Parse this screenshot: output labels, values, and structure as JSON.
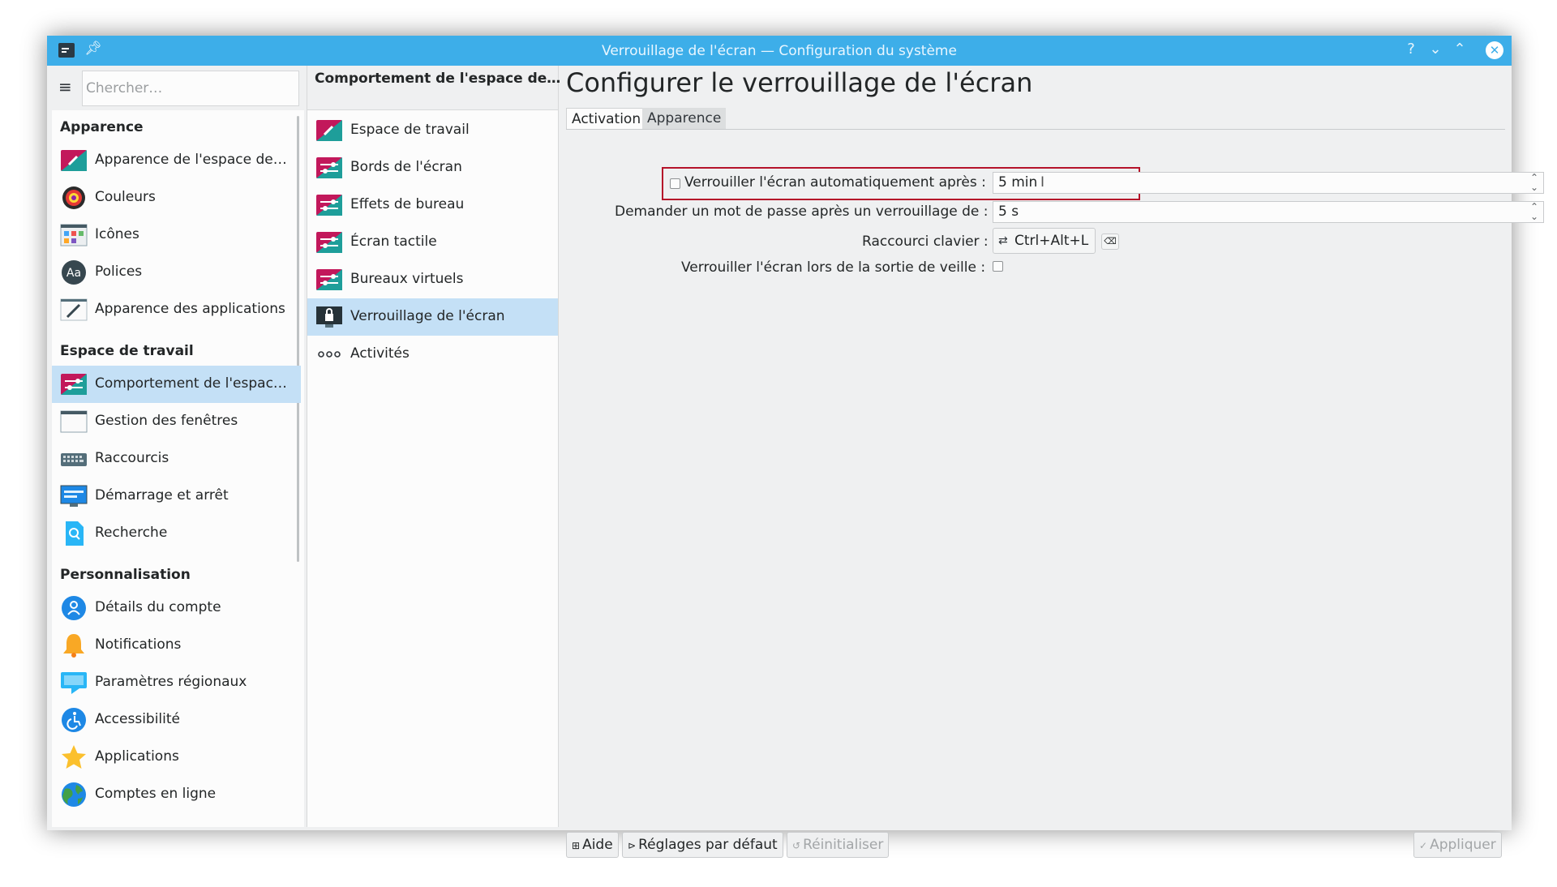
{
  "window": {
    "title": "Verrouillage de l'écran — Configuration du système",
    "controls": {
      "help": "?",
      "minimize": "⌄",
      "maximize": "⌃",
      "close": "✕"
    }
  },
  "sidebar": {
    "search_placeholder": "Chercher…",
    "sections": [
      {
        "title": "Apparence",
        "items": [
          {
            "label": "Apparence de l'espace de…",
            "icon": "workspace-theme-icon"
          },
          {
            "label": "Couleurs",
            "icon": "colors-icon"
          },
          {
            "label": "Icônes",
            "icon": "icons-icon"
          },
          {
            "label": "Polices",
            "icon": "fonts-icon"
          },
          {
            "label": "Apparence des applications",
            "icon": "app-style-icon"
          }
        ]
      },
      {
        "title": "Espace de travail",
        "items": [
          {
            "label": "Comportement de l'espac…",
            "icon": "workspace-behavior-icon",
            "selected": true
          },
          {
            "label": "Gestion des fenêtres",
            "icon": "window-management-icon"
          },
          {
            "label": "Raccourcis",
            "icon": "keyboard-icon"
          },
          {
            "label": "Démarrage et arrêt",
            "icon": "startup-shutdown-icon"
          },
          {
            "label": "Recherche",
            "icon": "search-icon"
          }
        ]
      },
      {
        "title": "Personnalisation",
        "items": [
          {
            "label": "Détails du compte",
            "icon": "user-icon"
          },
          {
            "label": "Notifications",
            "icon": "bell-icon"
          },
          {
            "label": "Paramètres régionaux",
            "icon": "regional-icon"
          },
          {
            "label": "Accessibilité",
            "icon": "accessibility-icon"
          },
          {
            "label": "Applications",
            "icon": "star-icon"
          },
          {
            "label": "Comptes en ligne",
            "icon": "globe-icon"
          }
        ]
      }
    ]
  },
  "middle": {
    "header": "Comportement de l'espace de…",
    "items": [
      {
        "label": "Espace de travail"
      },
      {
        "label": "Bords de l'écran"
      },
      {
        "label": "Effets de bureau"
      },
      {
        "label": "Écran tactile"
      },
      {
        "label": "Bureaux virtuels"
      },
      {
        "label": "Verrouillage de l'écran",
        "selected": true
      },
      {
        "label": "Activités"
      }
    ]
  },
  "content": {
    "title": "Configurer le verrouillage de l'écran",
    "tabs": [
      {
        "label": "Activation",
        "active": true
      },
      {
        "label": "Apparence",
        "active": false
      }
    ],
    "form": {
      "auto_lock_label": "Verrouiller l'écran automatiquement après :",
      "auto_lock_value": "5 min",
      "auto_lock_checked": false,
      "password_delay_label": "Demander un mot de passe après un verrouillage de :",
      "password_delay_value": "5 s",
      "shortcut_label": "Raccourci clavier :",
      "shortcut_value": "Ctrl+Alt+L",
      "resume_label": "Verrouiller l'écran lors de la sortie de veille :",
      "resume_checked": false
    },
    "footer": {
      "help": "Aide",
      "defaults": "Réglages par défaut",
      "reset": "Réinitialiser",
      "apply": "Appliquer"
    }
  }
}
